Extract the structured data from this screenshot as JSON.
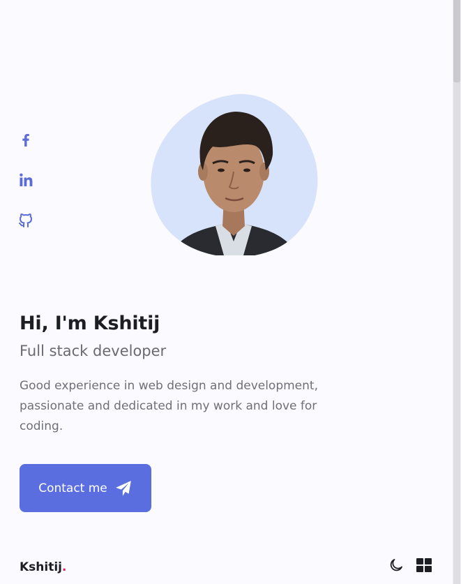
{
  "social": {
    "facebook_icon": "facebook-icon",
    "linkedin_icon": "linkedin-icon",
    "github_icon": "github-icon"
  },
  "hero": {
    "greeting": "Hi, I'm Kshitij",
    "role": "Full stack developer",
    "description": "Good experience in web design and development, passionate and dedicated in my work and love for coding.",
    "contact_label": "Contact me",
    "contact_icon": "send-icon"
  },
  "footer": {
    "brand": "Kshitij",
    "brand_dot": ".",
    "theme_icon": "moon-icon",
    "menu_icon": "grid-menu-icon"
  },
  "colors": {
    "accent": "#5a6ee0",
    "blob": "#d6e3fb",
    "text_dark": "#1d1d24",
    "text_muted": "#6f6f77",
    "brand_dot": "#e0245e"
  }
}
